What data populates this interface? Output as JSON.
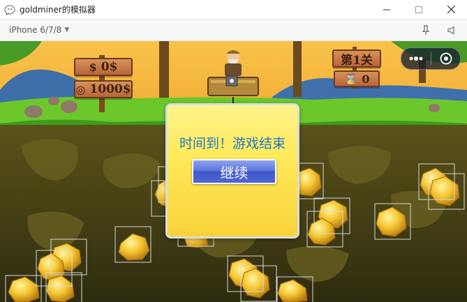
{
  "window": {
    "title": "goldminer的模拟器",
    "icon": "wechat-devtools-icon"
  },
  "toolbar": {
    "device": "iPhone 6/7/8",
    "icons": [
      "pin-icon",
      "volume-icon"
    ]
  },
  "game": {
    "money": "0$",
    "target": "1000$",
    "level": "第1关",
    "timer": "0",
    "dialog": {
      "title": "时间到！游戏结束",
      "button": "继续"
    },
    "colors": {
      "sky": "#f3b53c",
      "grass": "#6cc72a",
      "dirt": "#3c3a16",
      "dialog_title": "#1f76c4",
      "button": "#4f69d4"
    }
  }
}
